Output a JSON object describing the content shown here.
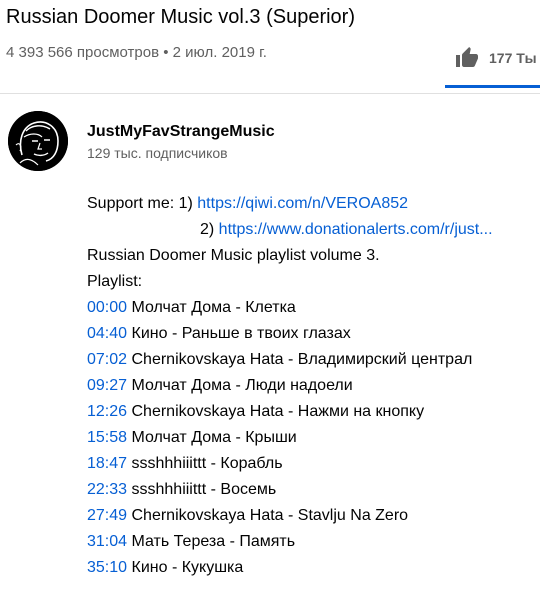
{
  "video": {
    "title": "Russian Doomer Music vol.3 (Superior)",
    "views": "4 393 566 просмотров",
    "separator": "•",
    "date": "2 июл. 2019 г.",
    "likes": "177 Ты"
  },
  "channel": {
    "name": "JustMyFavStrangeMusic",
    "subscribers": "129 тыс. подписчиков"
  },
  "description": {
    "support_label": "Support me: ",
    "support_links": [
      {
        "prefix": "1) ",
        "url": "https://qiwi.com/n/VEROA852"
      },
      {
        "prefix": "2) ",
        "url": "https://www.donationalerts.com/r/just..."
      }
    ],
    "intro": "Russian Doomer Music playlist volume 3.",
    "playlist_label": "Playlist:",
    "tracks": [
      {
        "time": "00:00",
        "name": "Молчат Дома - Клетка"
      },
      {
        "time": "04:40",
        "name": "Кино - Раньше в твоих глазах"
      },
      {
        "time": "07:02",
        "name": "Chernikovskaya Hata - Владимирский централ"
      },
      {
        "time": "09:27",
        "name": "Молчат Дома - Люди надоели"
      },
      {
        "time": "12:26",
        "name": "Chernikovskaya Hata - Нажми на кнопку"
      },
      {
        "time": "15:58",
        "name": "Молчат Дома - Крыши"
      },
      {
        "time": "18:47",
        "name": "ssshhhiiittt - Корабль"
      },
      {
        "time": "22:33",
        "name": "ssshhhiiittt - Восемь"
      },
      {
        "time": "27:49",
        "name": "Chernikovskaya Hata - Stavlju Na Zero"
      },
      {
        "time": "31:04",
        "name": "Мать Тереза - Память"
      },
      {
        "time": "35:10",
        "name": "Кино - Кукушка"
      }
    ]
  },
  "colors": {
    "link": "#065fd4",
    "text": "#030303",
    "secondary": "#606060"
  },
  "icons": {
    "like": "thumbs-up-icon",
    "avatar": "channel-avatar"
  }
}
